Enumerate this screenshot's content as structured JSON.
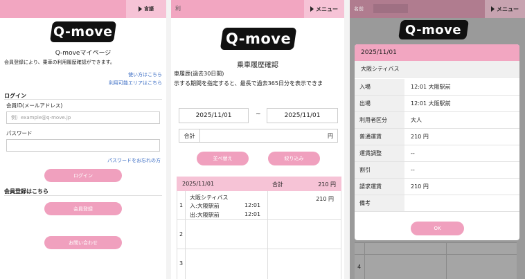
{
  "panel1": {
    "lang_label": "言語",
    "logo": "Q-move",
    "title": "Q-moveマイページ",
    "intro": "会員登録により、乗車の利用履歴確認ができます。",
    "link_howto": "使い方はこちら",
    "link_area": "利用可能エリアはこちら",
    "login_heading": "ログイン",
    "id_label": "会員ID(メールアドレス)",
    "id_placeholder": "例）example@q-move.jp",
    "password_label": "パスワード",
    "forgot_link": "パスワードをお忘れの方",
    "login_button": "ログイン",
    "register_heading": "会員登録はこちら",
    "register_button": "会員登録",
    "contact_button": "お問い合わせ"
  },
  "panel2": {
    "topbar_left": "利",
    "menu_label": "メニュー",
    "logo": "Q-move",
    "title": "乗車履歴確認",
    "subtitle": "車履歴(過去30日間)",
    "description": "示する期間を指定すると、最長で過去365日分を表示できま",
    "date_from": "2025/11/01",
    "date_sep": "~",
    "date_to": "2025/11/01",
    "total_label": "合計",
    "total_unit": "円",
    "sort_button": "並べ替え",
    "filter_button": "絞り込み",
    "table_header": {
      "date": "2025/11/01",
      "total_label": "合計",
      "total_value": "210 円"
    },
    "rows": [
      {
        "num": "1",
        "line": "大阪シティバス",
        "entry": "入:大阪駅前",
        "entry_time": "12:01",
        "exit": "出:大阪駅前",
        "exit_time": "12:01",
        "fare": "210 円"
      },
      {
        "num": "2"
      },
      {
        "num": "3"
      }
    ]
  },
  "panel3": {
    "topbar_left": "名前",
    "menu_label": "メニュー",
    "logo": "Q-move",
    "modal_date": "2025/11/01",
    "modal_line": "大阪シティバス",
    "details": [
      {
        "key": "入場",
        "value": "12:01  大阪駅前"
      },
      {
        "key": "出場",
        "value": "12:01  大阪駅前"
      },
      {
        "key": "利用者区分",
        "value": "大人"
      },
      {
        "key": "普通運賃",
        "value": "210  円"
      },
      {
        "key": "運賃調整",
        "value": "--"
      },
      {
        "key": "割引",
        "value": "--"
      },
      {
        "key": "請求運賃",
        "value": "210  円"
      },
      {
        "key": "備考",
        "value": ""
      }
    ],
    "ok_button": "OK",
    "bg_row": "4"
  }
}
